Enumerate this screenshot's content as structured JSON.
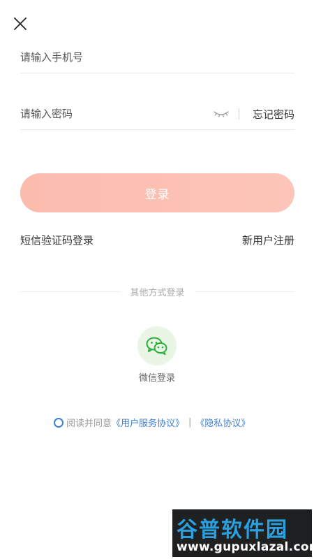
{
  "form": {
    "phone_placeholder": "请输入手机号",
    "password_placeholder": "请输入密码",
    "forgot_label": "忘记密码"
  },
  "login_button": {
    "label": "登录",
    "color_start": "#fbbcae",
    "color_end": "#fcc5b8"
  },
  "links": {
    "sms_login": "短信验证码登录",
    "register": "新用户注册"
  },
  "other_login": {
    "divider_text": "其他方式登录",
    "wechat_label": "微信登录",
    "wechat_icon": "wechat-icon",
    "wechat_color": "#2aae37"
  },
  "agreement": {
    "prefix": "阅读并同意",
    "user_agreement": "《用户服务协议》",
    "separator": "|",
    "privacy_policy": "《隐私协议》",
    "link_color": "#3f7fd6"
  },
  "watermark": {
    "text_cn": "谷普软件园",
    "url": "www.gupuxlazal.com"
  }
}
